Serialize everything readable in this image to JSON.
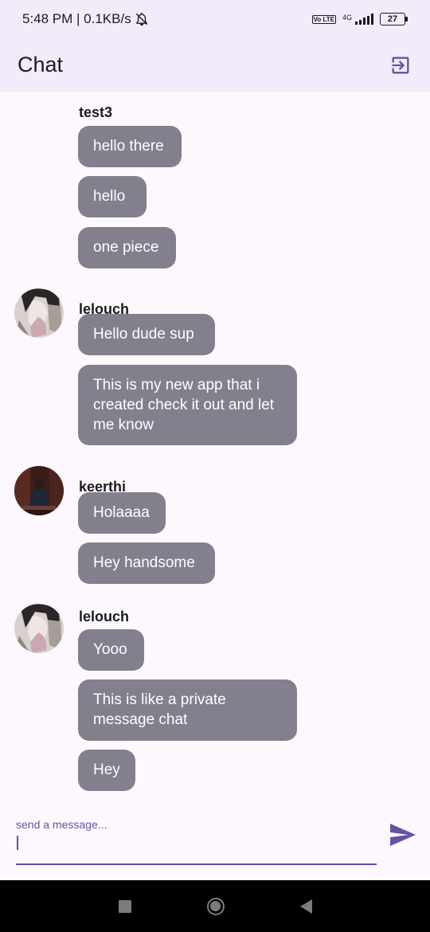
{
  "status_bar": {
    "time_speed": "5:48 PM | 0.1KB/s",
    "volte": "Vo LTE",
    "network": "4G",
    "battery": "27"
  },
  "app_bar": {
    "title": "Chat",
    "logout_icon": "logout-icon"
  },
  "messages": [
    {
      "user": "test3",
      "has_avatar": false,
      "texts": [
        "hello there",
        "hello",
        "one piece"
      ]
    },
    {
      "user": "lelouch",
      "has_avatar": true,
      "texts": [
        "Hello dude sup",
        "This is my new app that i created check it out and let me know"
      ]
    },
    {
      "user": "keerthi",
      "has_avatar": true,
      "texts": [
        "Holaaaa",
        "Hey handsome"
      ]
    },
    {
      "user": "lelouch",
      "has_avatar": true,
      "texts": [
        "Yooo",
        "This is like a private message chat",
        "Hey"
      ]
    }
  ],
  "composer": {
    "label": "send a message...",
    "value": "",
    "send_icon": "send-icon"
  },
  "nav": {
    "recents_icon": "recents-icon",
    "home_icon": "home-icon",
    "back_icon": "back-icon"
  },
  "colors": {
    "accent": "#6750a4",
    "bubble": "#837f8d",
    "app_bar": "#f3ebfa",
    "background": "#fdf8fd"
  }
}
